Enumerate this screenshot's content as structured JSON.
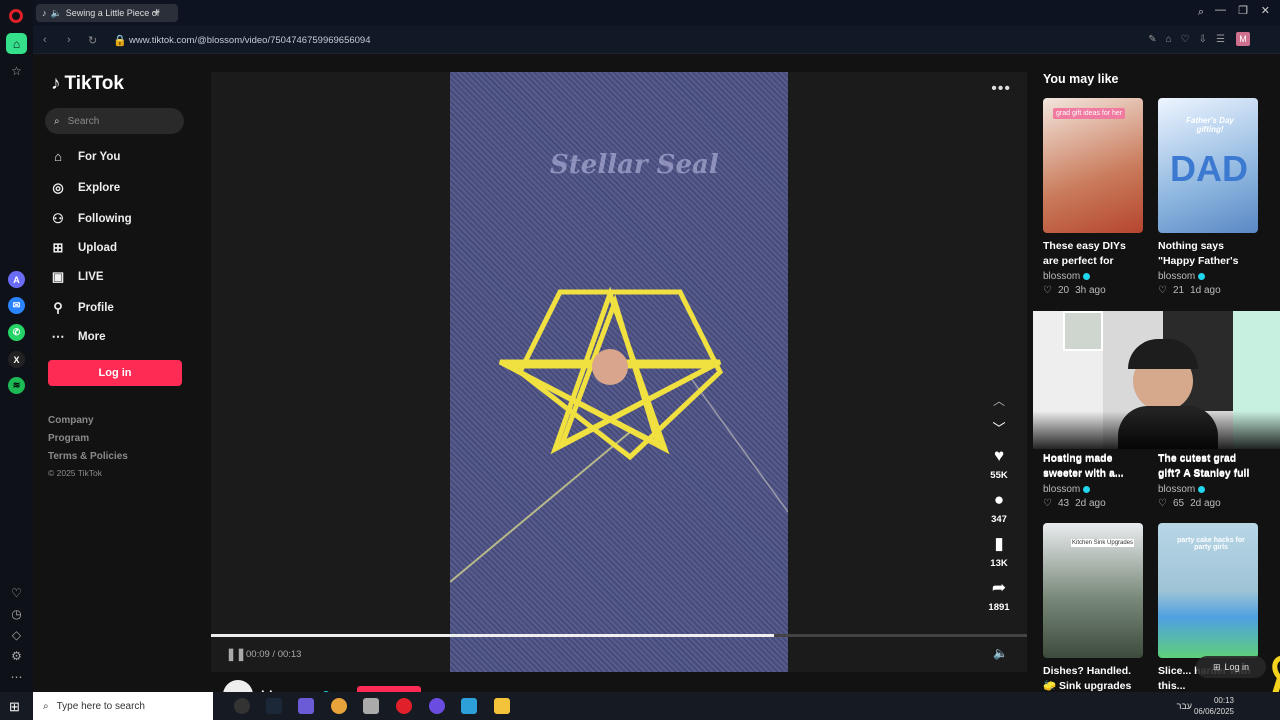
{
  "browser": {
    "tab_title": "Sewing a Little Piece of",
    "url": "www.tiktok.com/@blossom/video/7504746759969656094",
    "profile_initial": "M"
  },
  "tiktok": {
    "logo": "TikTok",
    "search_placeholder": "Search",
    "nav": [
      {
        "label": "For You",
        "icon": "home-icon"
      },
      {
        "label": "Explore",
        "icon": "compass-icon"
      },
      {
        "label": "Following",
        "icon": "following-icon"
      },
      {
        "label": "Upload",
        "icon": "plus-square-icon"
      },
      {
        "label": "LIVE",
        "icon": "live-icon"
      },
      {
        "label": "Profile",
        "icon": "user-icon"
      },
      {
        "label": "More",
        "icon": "more-icon"
      }
    ],
    "login": "Log in",
    "footer": [
      "Company",
      "Program",
      "Terms & Policies",
      "© 2025 TikTok"
    ]
  },
  "video": {
    "watermark": "Stellar Seal",
    "time": "00:09 / 00:13",
    "progress": 0.69,
    "author": "blossom",
    "actions": [
      {
        "icon": "heart-icon",
        "count": "55K"
      },
      {
        "icon": "comment-icon",
        "count": "347"
      },
      {
        "icon": "bookmark-icon",
        "count": "13K"
      },
      {
        "icon": "share-icon",
        "count": "1891"
      }
    ]
  },
  "recommendations": {
    "title": "You may like",
    "items": [
      {
        "caption": "These easy DIYs are perfect for grads...",
        "author": "blossom",
        "likes": "20",
        "age": "3h ago",
        "thumb_label": "grad gift ideas for her",
        "color": "#c97a5a"
      },
      {
        "caption": "Nothing says \"Happy Father's Day\" like...",
        "author": "blossom",
        "likes": "21",
        "age": "1d ago",
        "thumb_label": "Father's Day gifting!",
        "color": "#8fb7e0"
      },
      {
        "caption": "Hosting made sweeter with a...",
        "author": "blossom",
        "likes": "43",
        "age": "2d ago",
        "thumb_label": "",
        "color": "#e8c6c6"
      },
      {
        "caption": "The cutest grad gift? A Stanley full of...",
        "author": "blossom",
        "likes": "65",
        "age": "2d ago",
        "thumb_label": "",
        "color": "#d8b2c2"
      },
      {
        "caption": "Dishes? Handled. 🧽 Sink upgrades to...",
        "author": "",
        "likes": "",
        "age": "",
        "thumb_label": "Kitchen Sink Upgrades",
        "color": "#7a8a7a"
      },
      {
        "caption": "Slice... harder with this...",
        "author": "",
        "likes": "",
        "age": "",
        "thumb_label": "party cake hacks for party girls",
        "color": "#9fc4d6"
      }
    ]
  },
  "overlay": {
    "login": "Log in"
  },
  "taskbar": {
    "search_placeholder": "Type here to search",
    "lang": "עבר",
    "time": "00:13",
    "date": "06/06/2025"
  }
}
